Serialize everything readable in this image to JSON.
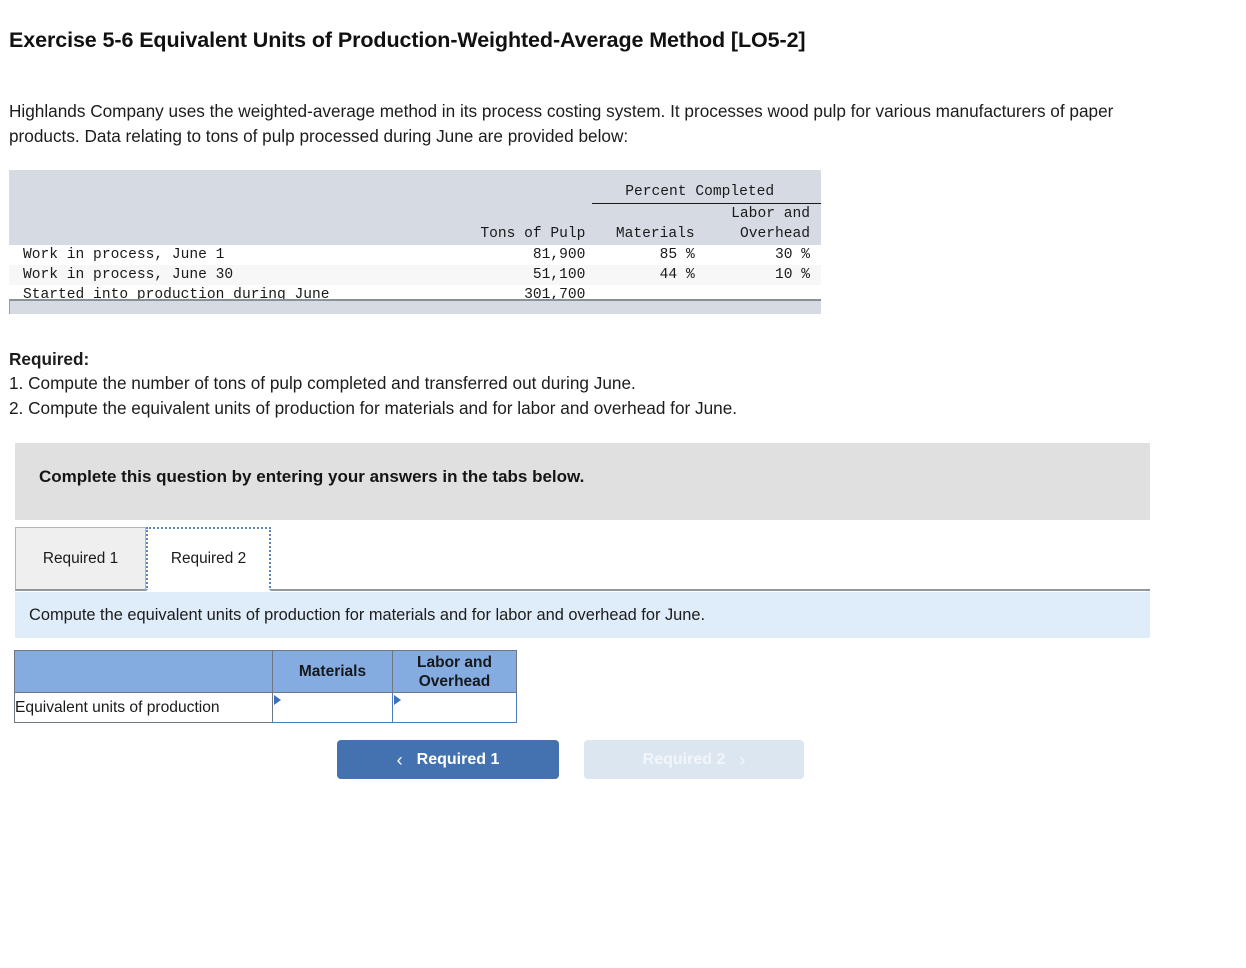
{
  "page_title": "Exercise 5-6 Equivalent Units of Production-Weighted-Average Method [LO5-2]",
  "intro": "Highlands Company uses the weighted-average method in its process costing system. It processes wood pulp for various manufacturers of paper products. Data relating to tons of pulp processed during June are provided below:",
  "data_table": {
    "group_header": "Percent Completed",
    "columns": {
      "label": "",
      "tons": "Tons of Pulp",
      "materials": "Materials",
      "labor_overhead_line1": "Labor and",
      "labor_overhead_line2": "Overhead"
    },
    "rows": [
      {
        "label": "Work in process, June 1",
        "tons": "81,900",
        "materials": "85 %",
        "labor_overhead": "30 %"
      },
      {
        "label": "Work in process, June 30",
        "tons": "51,100",
        "materials": "44 %",
        "labor_overhead": "10 %"
      },
      {
        "label": "Started into production during June",
        "tons": "301,700",
        "materials": "",
        "labor_overhead": ""
      }
    ]
  },
  "required": {
    "heading": "Required:",
    "item1": "1. Compute the number of tons of pulp completed and transferred out during June.",
    "item2": "2. Compute the equivalent units of production for materials and for labor and overhead for June."
  },
  "gray_banner": {
    "text": "Complete this question by entering your answers in the tabs below."
  },
  "tabs": [
    {
      "label": "Required 1",
      "active": false
    },
    {
      "label": "Required 2",
      "active": true
    }
  ],
  "blue_bar": {
    "text": "Compute the equivalent units of production for materials and for labor and overhead for June."
  },
  "answer_table": {
    "headers": {
      "blank": "",
      "materials": "Materials",
      "labor_overhead_line1": "Labor and",
      "labor_overhead_line2": "Overhead"
    },
    "row_label": "Equivalent units of production",
    "materials_value": "",
    "labor_overhead_value": ""
  },
  "nav": {
    "prev_label": "Required 1",
    "prev_chevron": "‹",
    "next_label": "Required 2",
    "next_chevron": "›"
  },
  "colors": {
    "accent_blue": "#4472b0",
    "header_blue": "#85ace0",
    "data_table_bg": "#d6dae3",
    "gray_banner": "#e0e0e0",
    "blue_bar": "#dfecf9"
  }
}
